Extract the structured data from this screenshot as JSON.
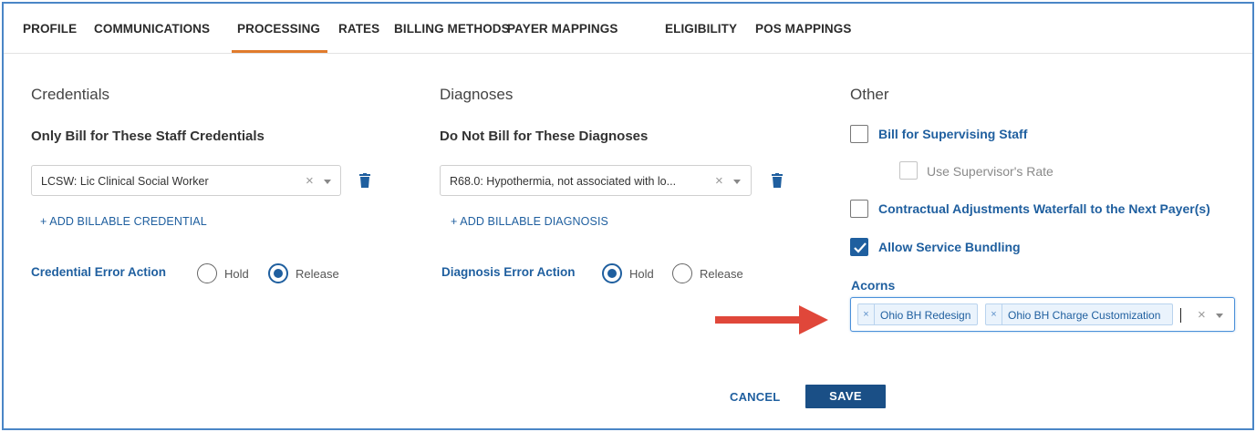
{
  "tabs": [
    {
      "label": "PROFILE"
    },
    {
      "label": "COMMUNICATIONS"
    },
    {
      "label": "PROCESSING",
      "active": true
    },
    {
      "label": "RATES"
    },
    {
      "label": "BILLING METHODS"
    },
    {
      "label": "PAYER MAPPINGS"
    },
    {
      "label": "ELIGIBILITY"
    },
    {
      "label": "POS MAPPINGS"
    }
  ],
  "credentials": {
    "section_title": "Credentials",
    "field_label": "Only Bill for These Staff Credentials",
    "selected_value": "LCSW: Lic Clinical Social Worker",
    "add_link": "+ ADD BILLABLE CREDENTIAL",
    "error_action_label": "Credential Error Action",
    "options": [
      "Hold",
      "Release"
    ],
    "selected_option": "Release"
  },
  "diagnoses": {
    "section_title": "Diagnoses",
    "field_label": "Do Not Bill for These Diagnoses",
    "selected_value": "R68.0: Hypothermia, not associated with lo...",
    "add_link": "+ ADD BILLABLE DIAGNOSIS",
    "error_action_label": "Diagnosis Error Action",
    "options": [
      "Hold",
      "Release"
    ],
    "selected_option": "Hold"
  },
  "other": {
    "section_title": "Other",
    "checkboxes": [
      {
        "label": "Bill for Supervising Staff",
        "checked": false,
        "disabled": false
      },
      {
        "label": "Use Supervisor's Rate",
        "checked": false,
        "disabled": true
      },
      {
        "label": "Contractual Adjustments Waterfall to the Next Payer(s)",
        "checked": false,
        "disabled": false
      },
      {
        "label": "Allow Service Bundling",
        "checked": true,
        "disabled": false
      }
    ],
    "acorns_label": "Acorns",
    "acorns_selected": [
      "Ohio BH Redesign",
      "Ohio BH Charge Customization"
    ]
  },
  "icons": {
    "clear": "×",
    "chip_remove": "×"
  },
  "actions": {
    "cancel_label": "CANCEL",
    "save_label": "SAVE"
  },
  "colors": {
    "accent_blue": "#1f5f9f",
    "tab_underline": "#e07b2c",
    "save_button": "#1a4f86",
    "arrow_red": "#e0473a",
    "frame_border": "#4a86c6"
  }
}
